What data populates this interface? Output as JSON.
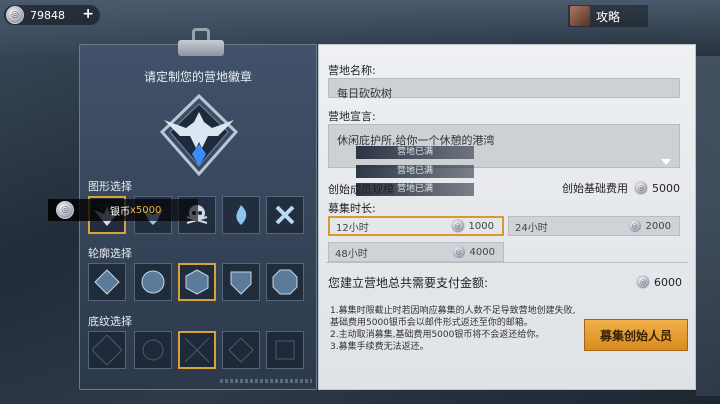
{
  "topbar": {
    "silver": "79848",
    "plus": "+",
    "strategy_label": "攻略"
  },
  "left": {
    "title": "请定制您的营地徽章",
    "shape_label": "图形选择",
    "outline_label": "轮廓选择",
    "pattern_label": "底纹选择",
    "tooltip_label": "银币",
    "tooltip_value": "x5000"
  },
  "right": {
    "name_label": "营地名称:",
    "name_value": "每日砍砍树",
    "slogan_label": "营地宣言:",
    "slogan_value": "休闲庇护所,给你一个休憩的港湾",
    "full_chips": [
      "营地已满",
      "营地已满",
      "营地已满"
    ],
    "size_label": "创始成员规模",
    "base_fee_label": "创始基础费用",
    "base_fee": "5000",
    "duration_label": "募集时长:",
    "durations": [
      {
        "label": "12小时",
        "cost": "1000"
      },
      {
        "label": "24小时",
        "cost": "2000"
      },
      {
        "label": "48小时",
        "cost": "4000"
      }
    ],
    "total_label": "您建立营地总共需要支付金额:",
    "total": "6000",
    "notes": [
      "1.募集时限截止时若因响应募集的人数不足导致营地创建失败,基础费用5000银币会以邮件形式返还至你的邮箱。",
      "2.主动取消募集,基础费用5000银币将不会返还给你。",
      "3.募集手续费无法返还。"
    ],
    "recruit_button": "募集创始人员"
  }
}
